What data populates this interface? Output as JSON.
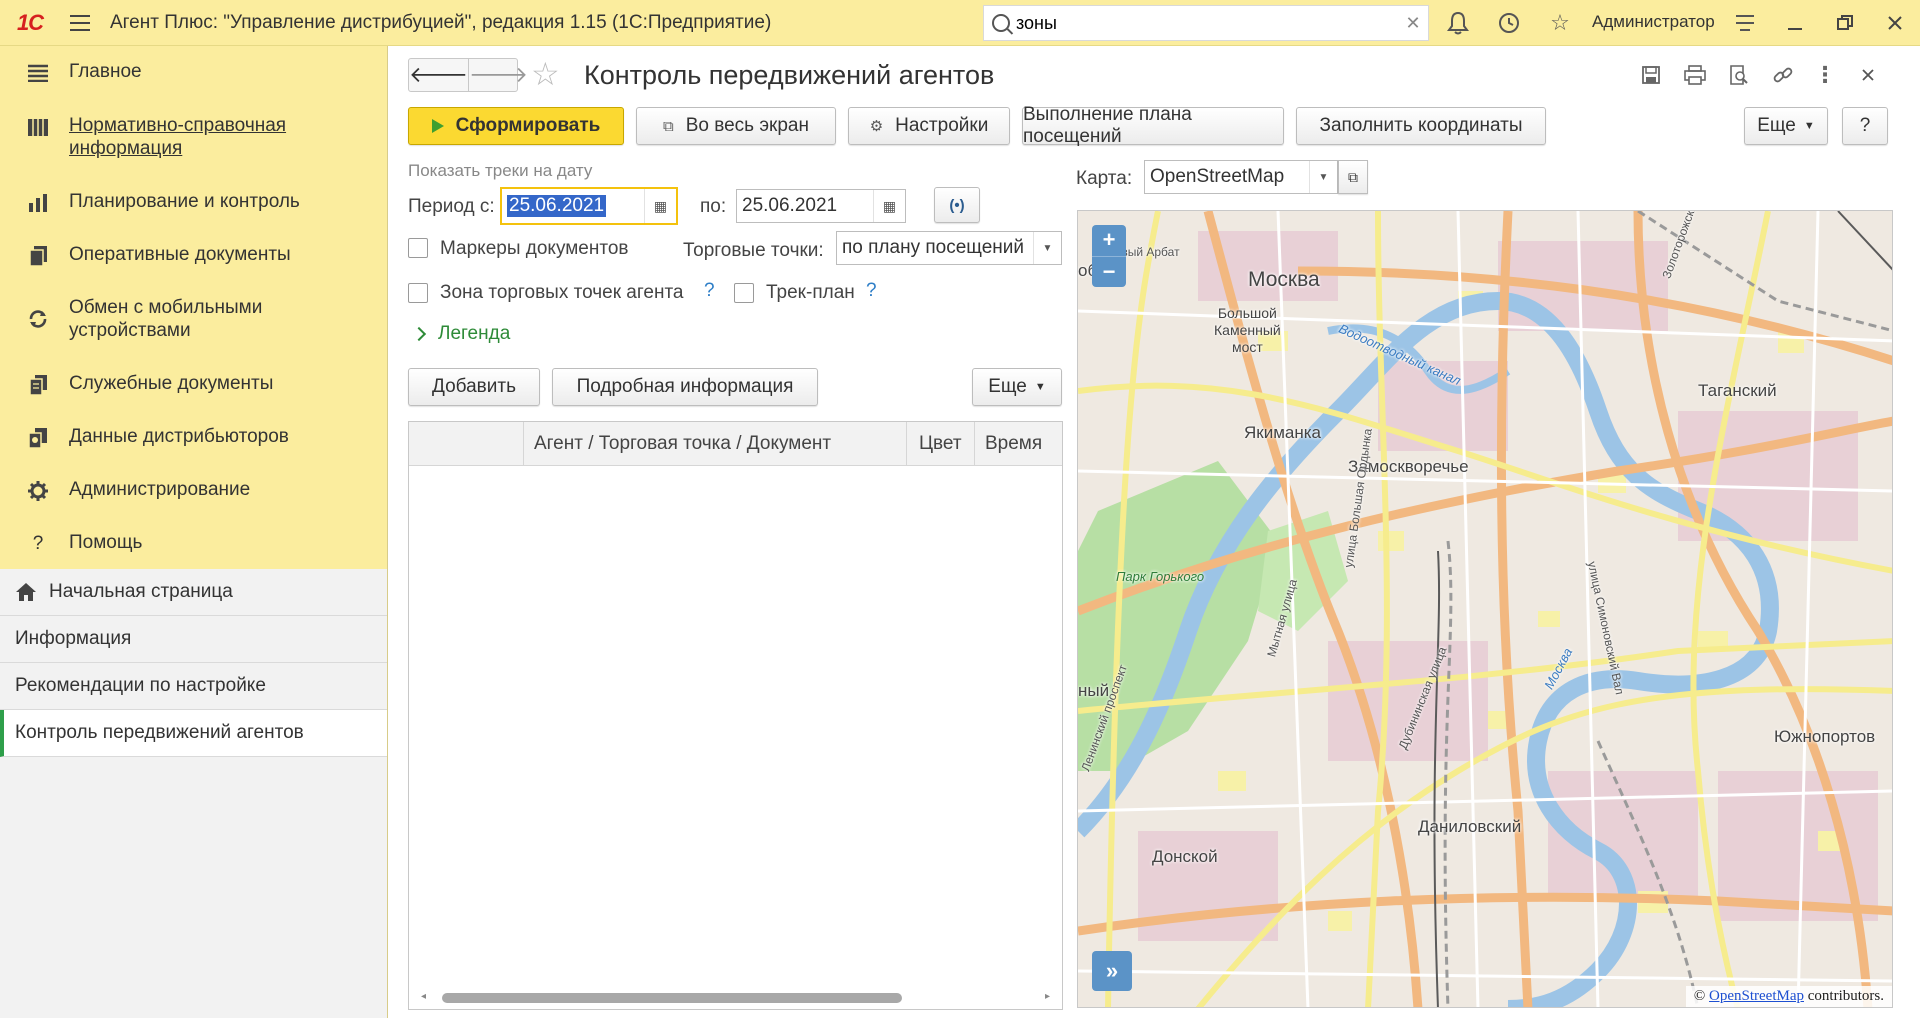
{
  "titlebar": {
    "logo": "1С",
    "title": "Агент Плюс: \"Управление дистрибуцией\", редакция 1.15  (1С:Предприятие)",
    "search_value": "зоны",
    "user": "Администратор"
  },
  "sidebar": {
    "items": [
      {
        "label": "Главное",
        "icon": "menu-list-icon",
        "link": false
      },
      {
        "label": "Нормативно-справочная информация",
        "icon": "catalog-icon",
        "link": true
      },
      {
        "label": "Планирование и контроль",
        "icon": "chart-icon",
        "link": false
      },
      {
        "label": "Оперативные документы",
        "icon": "documents-icon",
        "link": false
      },
      {
        "label": "Обмен с мобильными устройствами",
        "icon": "sync-icon",
        "link": false
      },
      {
        "label": "Служебные документы",
        "icon": "service-docs-icon",
        "link": false
      },
      {
        "label": "Данные дистрибьюторов",
        "icon": "distributor-data-icon",
        "link": false
      },
      {
        "label": "Администрирование",
        "icon": "gear-icon",
        "link": false
      },
      {
        "label": "Помощь",
        "icon": "help-icon",
        "link": false
      }
    ],
    "open_windows": [
      {
        "label": "Начальная страница",
        "active": false,
        "icon": "home-icon"
      },
      {
        "label": "Информация",
        "active": false
      },
      {
        "label": "Рекомендации по настройке",
        "active": false
      },
      {
        "label": "Контроль передвижений агентов",
        "active": true
      }
    ]
  },
  "form": {
    "title": "Контроль передвижений агентов",
    "buttons": {
      "generate": "Сформировать",
      "fullscreen": "Во весь экран",
      "settings": "Настройки",
      "visit_plan": "Выполнение плана посещений",
      "fill_coords": "Заполнить координаты",
      "more": "Еще",
      "help": "?"
    },
    "tracks_caption": "Показать треки на дату",
    "period_from_label": "Период с:",
    "period_from": "25.06.2021",
    "period_to_label": "по:",
    "period_to": "25.06.2021",
    "period_btn": "(•)",
    "doc_markers_label": "Маркеры документов",
    "trade_points_label": "Торговые точки:",
    "trade_points_value": "по плану посещений",
    "agent_zone_label": "Зона торговых точек агента",
    "track_plan_label": "Трек-план",
    "help_q": "?",
    "legend": "Легенда",
    "add_btn": "Добавить",
    "details_btn": "Подробная информация",
    "more_btn": "Еще",
    "table_headers": [
      "",
      "Агент / Торговая точка / Документ",
      "Цвет",
      "Время"
    ],
    "map_label": "Карта:",
    "map_value": "OpenStreetMap"
  },
  "map": {
    "zoom_in": "+",
    "zoom_out": "−",
    "expand": "»",
    "attribution_prefix": "©",
    "attribution_link": "OpenStreetMap",
    "attribution_suffix": "contributors.",
    "labels": {
      "moskva": "Москва",
      "bolshoy": "Большой\nКаменный\nмост",
      "yakimanka": "Якиманка",
      "zamoskvorechye": "Замоскворечье",
      "taganskiy": "Таганский",
      "park": "Парк Горького",
      "yuzhnoport": "Южнопортов",
      "danilovskiy": "Даниловский",
      "donskoy": "Донской",
      "vodootvodny": "Водоотводный канал",
      "novy_arbat": "Новый Арбат",
      "ordynka": "улица Большая Ордынка",
      "mytnaya": "Мытная улица",
      "dubininskaya": "Дубининская улица",
      "moskva_river": "Москва",
      "simonovsky": "улица Симоновский Вал",
      "leninsky": "Ленинский проспект",
      "zolotorozhsky": "Золоторожский",
      "fragment_ob": "об",
      "fragment_ny": "ный"
    }
  }
}
